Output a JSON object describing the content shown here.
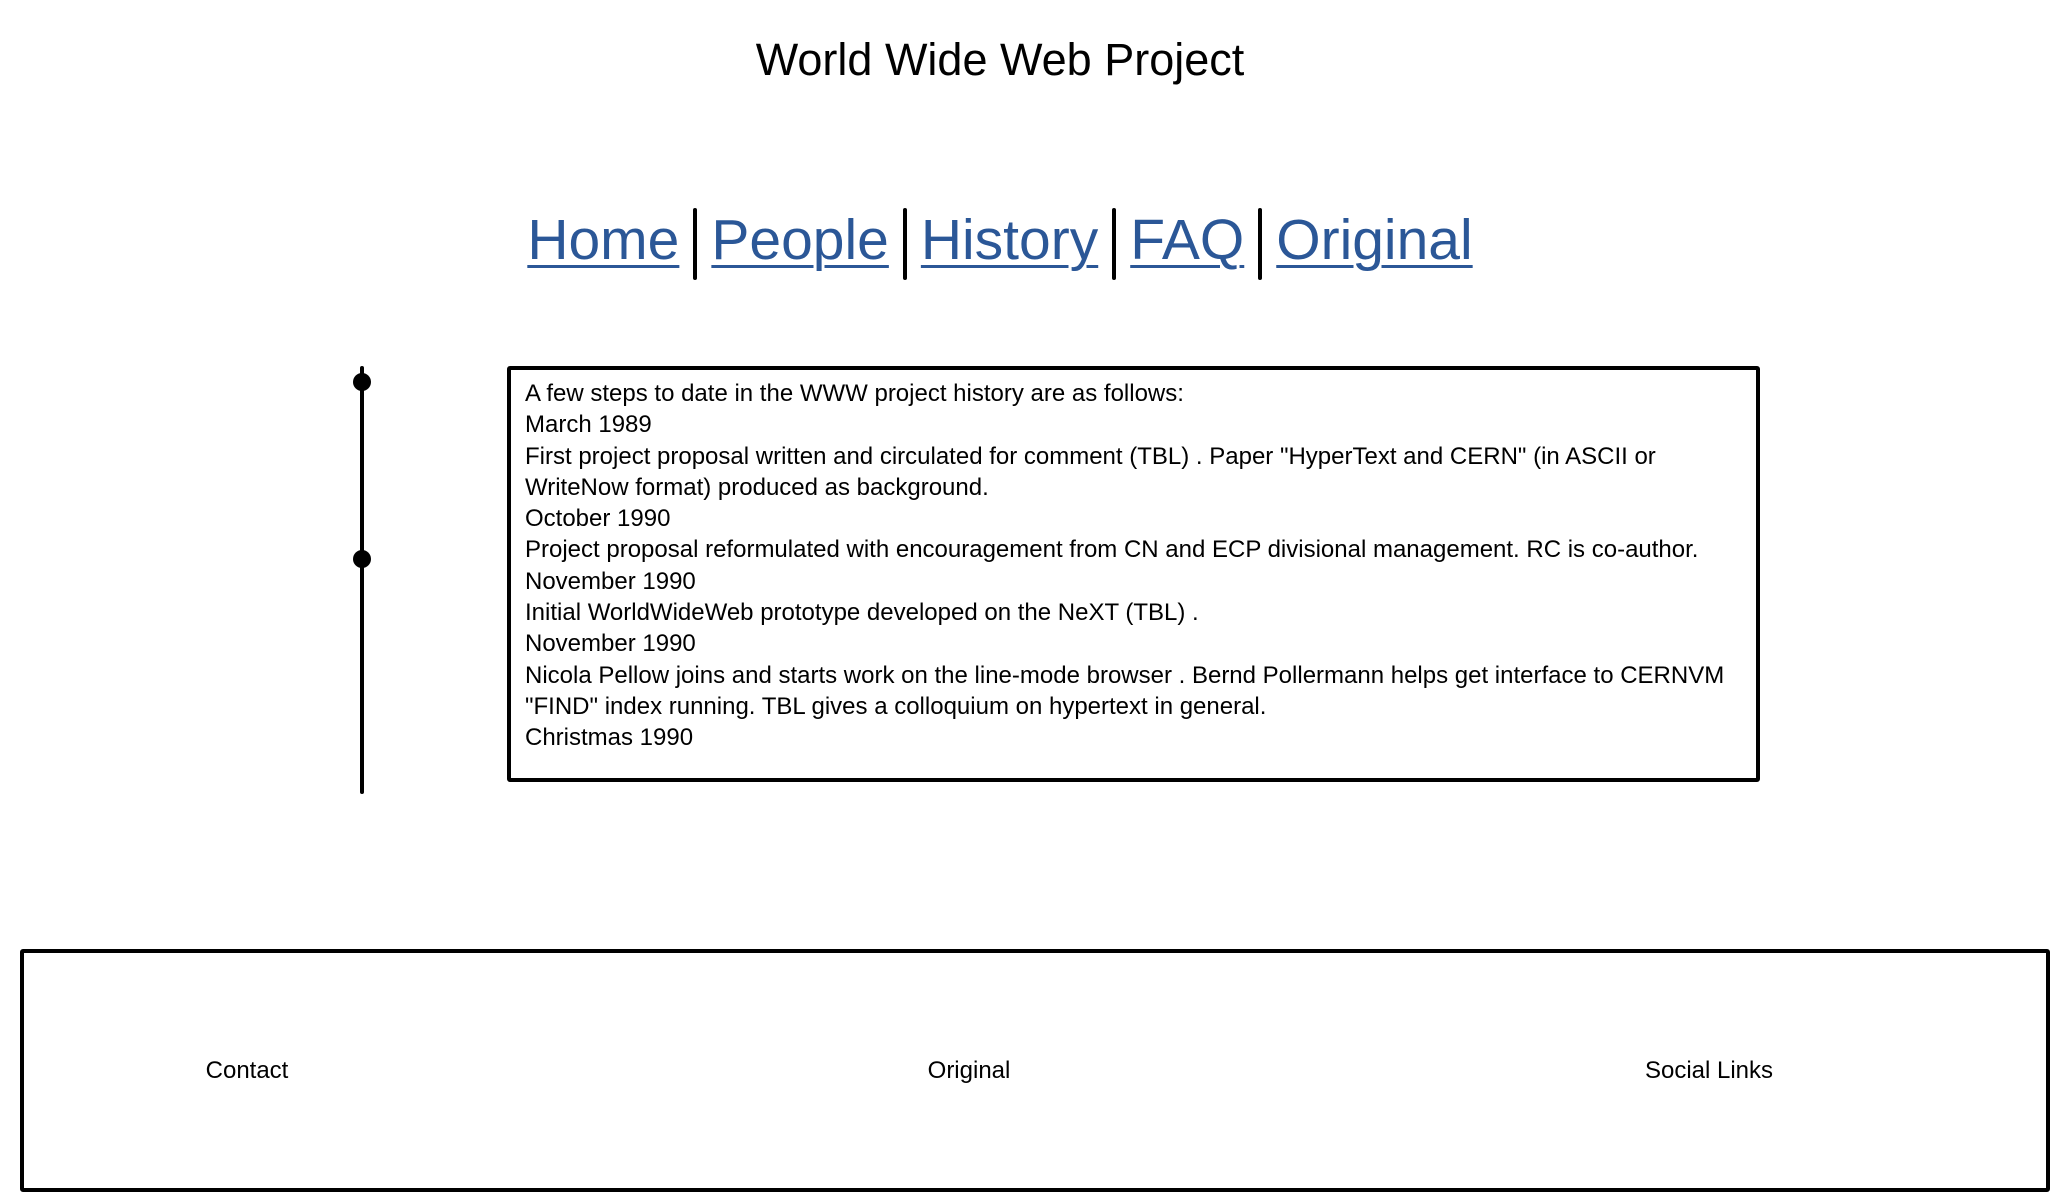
{
  "header": {
    "title": "World Wide Web Project"
  },
  "nav": {
    "items": [
      {
        "label": "Home"
      },
      {
        "label": "People"
      },
      {
        "label": "History"
      },
      {
        "label": "FAQ"
      },
      {
        "label": "Original"
      }
    ],
    "link_color": "#2b5797"
  },
  "history": {
    "lines": [
      "A few steps to date in the WWW project history are as follows:",
      "March 1989",
      "First project proposal written and circulated for comment (TBL) . Paper \"HyperText and CERN\" (in ASCII or WriteNow format) produced as background.",
      "October 1990",
      "Project proposal reformulated with encouragement from CN and ECP divisional management. RC is co-author.",
      "November 1990",
      "Initial WorldWideWeb prototype developed on the NeXT (TBL) .",
      "November 1990",
      "Nicola Pellow joins and starts work on the line-mode browser . Bernd Pollermann helps get interface to CERNVM \"FIND\" index running. TBL gives a colloquium on hypertext in general.",
      "Christmas 1990"
    ]
  },
  "footer": {
    "contact": "Contact",
    "original": "Original",
    "social": "Social Links"
  }
}
